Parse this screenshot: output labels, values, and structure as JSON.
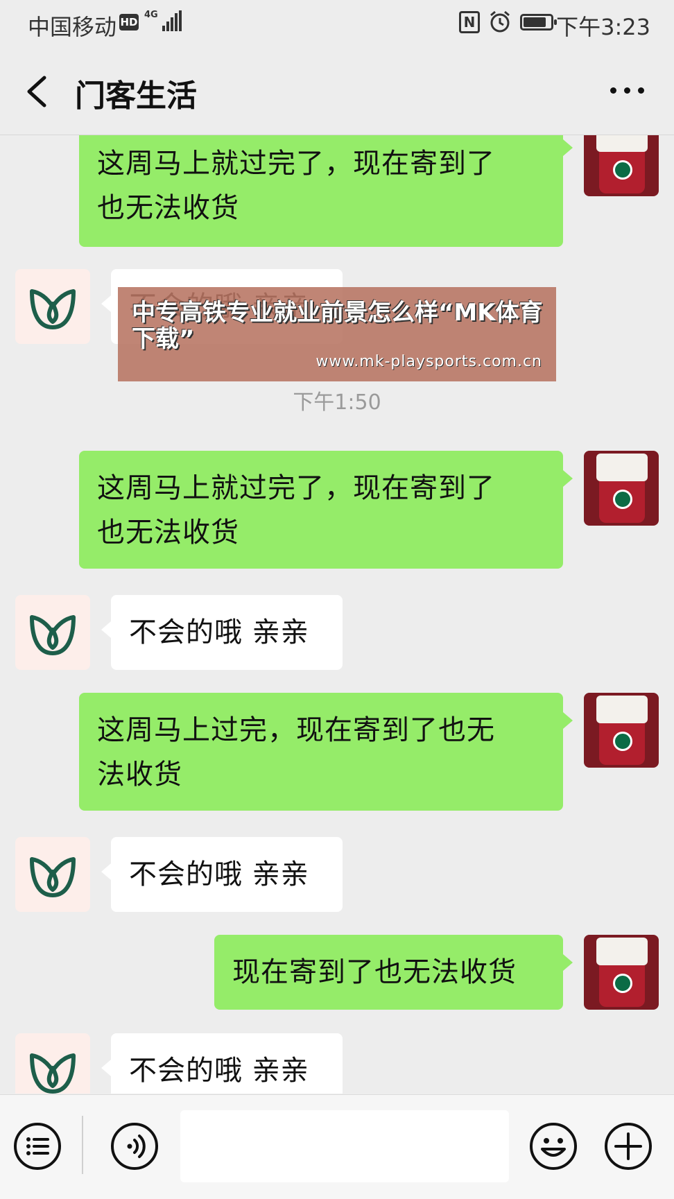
{
  "status_bar": {
    "carrier": "中国移动",
    "hd": "HD",
    "network": "4G",
    "time": "下午3:23",
    "battery_level": 0.85
  },
  "header": {
    "title": "门客生活"
  },
  "messages": [
    {
      "from": "me",
      "text": "这周马上就过完了，现在寄到了\n也无法收货"
    },
    {
      "from": "them",
      "text": "不会的哦 亲亲"
    },
    {
      "type": "timestamp",
      "text": "下午1:50"
    },
    {
      "from": "me",
      "text": "这周马上就过完了，现在寄到了\n也无法收货"
    },
    {
      "from": "them",
      "text": "不会的哦 亲亲"
    },
    {
      "from": "me",
      "text": "这周马上过完，现在寄到了也无\n法收货"
    },
    {
      "from": "them",
      "text": "不会的哦 亲亲"
    },
    {
      "from": "me",
      "text": "现在寄到了也无法收货"
    },
    {
      "from": "them",
      "text": "不会的哦 亲亲"
    }
  ],
  "promo": {
    "headline": "中专高铁专业就业前景怎么样“MK体育下载”",
    "url": "www.mk-playsports.com.cn"
  },
  "toolbar": {
    "input_value": ""
  },
  "colors": {
    "my_bubble": "#95ec69",
    "their_bubble": "#ffffff",
    "background": "#ededed"
  },
  "icons": [
    "back-icon",
    "more-icon",
    "menu-icon",
    "voice-icon",
    "emoji-icon",
    "add-icon"
  ]
}
